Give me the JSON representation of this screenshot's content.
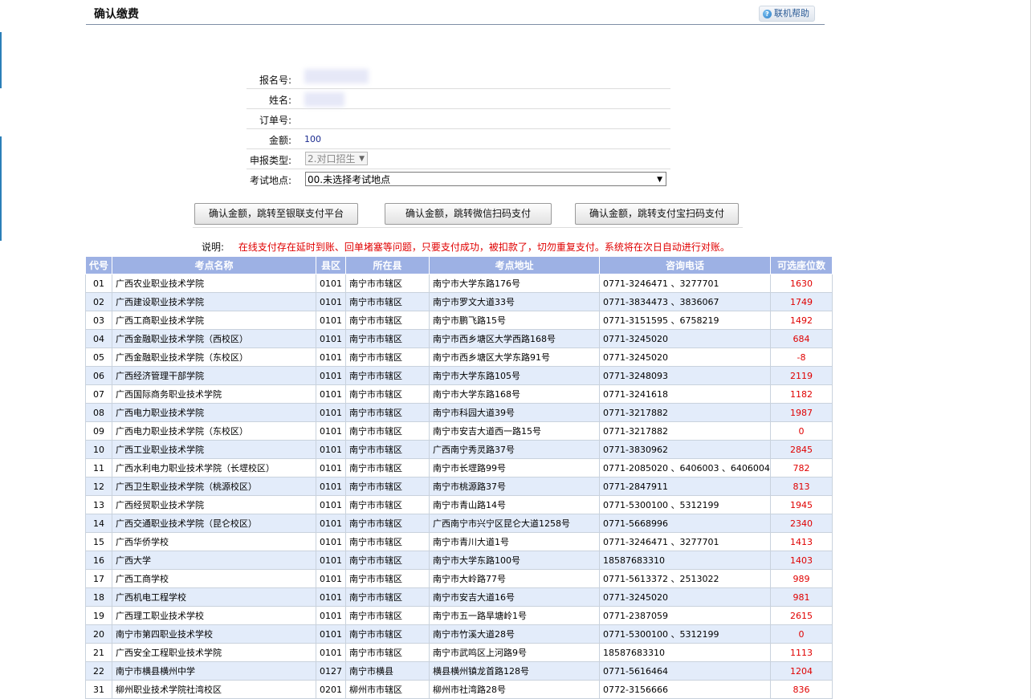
{
  "header": {
    "title": "确认缴费",
    "help_label": "联机帮助",
    "help_icon": "help-icon"
  },
  "form": {
    "reg_no_label": "报名号",
    "name_label": "姓名",
    "order_label": "订单号",
    "amount_label": "金额",
    "amount_value": "100",
    "type_label": "申报类型",
    "type_value": "2.对口招生",
    "location_label": "考试地点",
    "location_value": "00.未选择考试地点"
  },
  "buttons": {
    "unionpay": "确认金额，跳转至银联支付平台",
    "wechat": "确认金额，跳转微信扫码支付",
    "alipay": "确认金额，跳转支付宝扫码支付"
  },
  "note": {
    "label": "说明:",
    "text": "在线支付存在延时到账、回单堵塞等问题，只要支付成功，被扣款了，切勿重复支付。系统将在次日自动进行对账。"
  },
  "table": {
    "headers": [
      "代号",
      "考点名称",
      "县区",
      "所在县",
      "考点地址",
      "咨询电话",
      "可选座位数"
    ],
    "rows": [
      [
        "01",
        "广西农业职业技术学院",
        "0101",
        "南宁市市辖区",
        "南宁市大学东路176号",
        "0771-3246471 、3277701",
        "1630"
      ],
      [
        "02",
        "广西建设职业技术学院",
        "0101",
        "南宁市市辖区",
        "南宁市罗文大道33号",
        "0771-3834473 、3836067",
        "1749"
      ],
      [
        "03",
        "广西工商职业技术学院",
        "0101",
        "南宁市市辖区",
        "南宁市鹏飞路15号",
        "0771-3151595 、6758219",
        "1492"
      ],
      [
        "04",
        "广西金融职业技术学院（西校区）",
        "0101",
        "南宁市市辖区",
        "南宁市西乡塘区大学西路168号",
        "0771-3245020",
        "684"
      ],
      [
        "05",
        "广西金融职业技术学院（东校区）",
        "0101",
        "南宁市市辖区",
        "南宁市西乡塘区大学东路91号",
        "0771-3245020",
        "-8"
      ],
      [
        "06",
        "广西经济管理干部学院",
        "0101",
        "南宁市市辖区",
        "南宁市大学东路105号",
        "0771-3248093",
        "2119"
      ],
      [
        "07",
        "广西国际商务职业技术学院",
        "0101",
        "南宁市市辖区",
        "南宁市大学东路168号",
        "0771-3241618",
        "1182"
      ],
      [
        "08",
        "广西电力职业技术学院",
        "0101",
        "南宁市市辖区",
        "南宁市科园大道39号",
        "0771-3217882",
        "1987"
      ],
      [
        "09",
        "广西电力职业技术学院（东校区）",
        "0101",
        "南宁市市辖区",
        "南宁市安吉大道西一路15号",
        "0771-3217882",
        "0"
      ],
      [
        "10",
        "广西工业职业技术学院",
        "0101",
        "南宁市市辖区",
        "广西南宁秀灵路37号",
        "0771-3830962",
        "2845"
      ],
      [
        "11",
        "广西水利电力职业技术学院（长堽校区）",
        "0101",
        "南宁市市辖区",
        "南宁市长堽路99号",
        "0771-2085020 、6406003 、6406004",
        "782"
      ],
      [
        "12",
        "广西卫生职业技术学院（桃源校区）",
        "0101",
        "南宁市市辖区",
        "南宁市桃源路37号",
        "0771-2847911",
        "813"
      ],
      [
        "13",
        "广西经贸职业技术学院",
        "0101",
        "南宁市市辖区",
        "南宁市青山路14号",
        "0771-5300100 、5312199",
        "1945"
      ],
      [
        "14",
        "广西交通职业技术学院（昆仑校区）",
        "0101",
        "南宁市市辖区",
        "广西南宁市兴宁区昆仑大道1258号",
        "0771-5668996",
        "2340"
      ],
      [
        "15",
        "广西华侨学校",
        "0101",
        "南宁市市辖区",
        "南宁市青川大道1号",
        "0771-3246471 、3277701",
        "1413"
      ],
      [
        "16",
        "广西大学",
        "0101",
        "南宁市市辖区",
        "南宁市大学东路100号",
        "18587683310",
        "1403"
      ],
      [
        "17",
        "广西工商学校",
        "0101",
        "南宁市市辖区",
        "南宁市大岭路77号",
        "0771-5613372 、2513022",
        "989"
      ],
      [
        "18",
        "广西机电工程学校",
        "0101",
        "南宁市市辖区",
        "南宁市安吉大道16号",
        "0771-3245020",
        "981"
      ],
      [
        "19",
        "广西理工职业技术学校",
        "0101",
        "南宁市市辖区",
        "南宁市五一路旱塘岭1号",
        "0771-2387059",
        "2615"
      ],
      [
        "20",
        "南宁市第四职业技术学校",
        "0101",
        "南宁市市辖区",
        "南宁市竹溪大道28号",
        "0771-5300100 、5312199",
        "0"
      ],
      [
        "21",
        "广西安全工程职业技术学院",
        "0101",
        "南宁市市辖区",
        "南宁市武鸣区上河路9号",
        "18587683310",
        "1113"
      ],
      [
        "22",
        "南宁市横县横州中学",
        "0127",
        "南宁市横县",
        "横县横州镇龙首路128号",
        "0771-5616464",
        "1204"
      ],
      [
        "31",
        "柳州职业技术学院社湾校区",
        "0201",
        "柳州市市辖区",
        "柳州市社湾路28号",
        "0772-3156666",
        "836"
      ]
    ]
  }
}
